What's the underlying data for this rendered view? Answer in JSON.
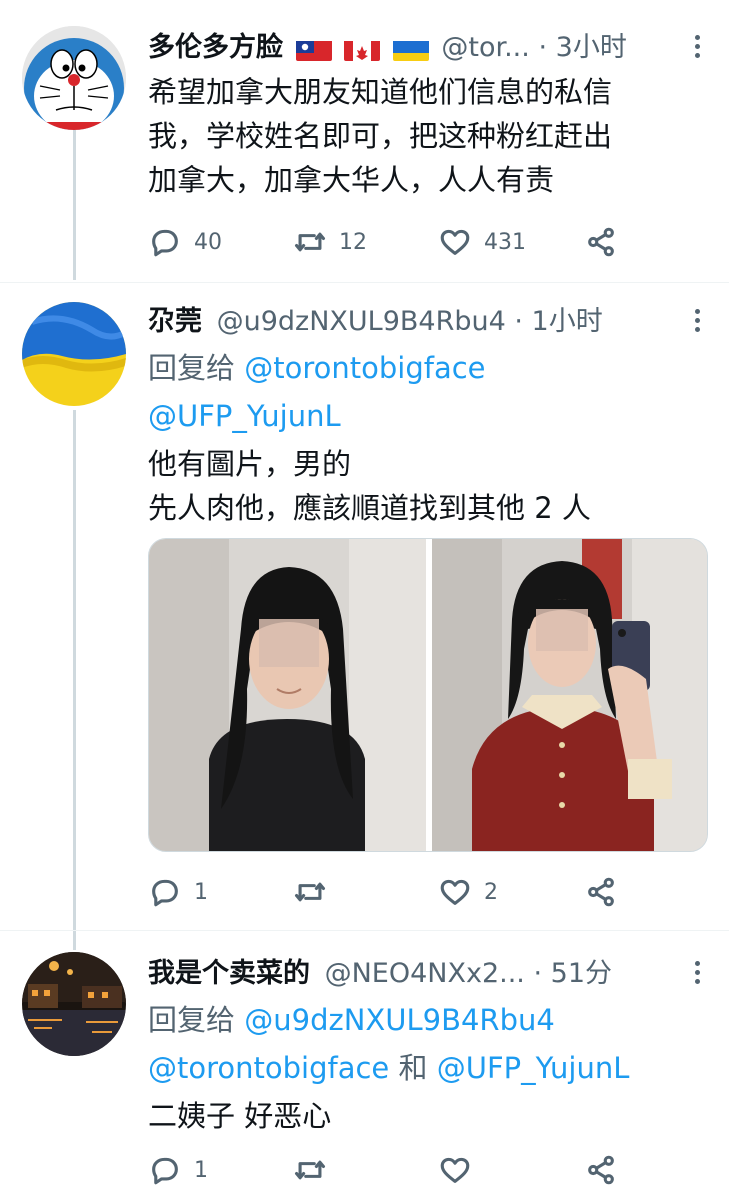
{
  "tweets": [
    {
      "name": "多伦多方脸",
      "flags": [
        "taiwan-flag",
        "canada-flag",
        "ukraine-flag"
      ],
      "handle": "@tor...",
      "dot": "·",
      "time": "3小时",
      "text_lines": [
        "希望加拿大朋友知道他们信息的私信",
        "我，学校姓名即可，把这种粉红赶出",
        "加拿大，加拿大华人，人人有责"
      ],
      "replies": "40",
      "retweets": "12",
      "likes": "431",
      "avatar": "doraemon-avatar"
    },
    {
      "name": "尕莞",
      "handle": "@u9dzNXUL9B4Rbu4",
      "dot": "·",
      "time": "1小时",
      "reply_prefix": "回复给",
      "reply_users": [
        "@torontobigface",
        "@UFP_YujunL"
      ],
      "text_lines": [
        "他有圖片，男的",
        "先人肉他，應該順道找到其他 2 人"
      ],
      "replies": "1",
      "retweets": "",
      "likes": "2",
      "avatar": "ukraine-flag-avatar"
    },
    {
      "name": "我是个卖菜的",
      "handle": "@NEO4NXx2...",
      "dot": "·",
      "time": "51分",
      "reply_prefix": "回复给",
      "reply_users": [
        "@u9dzNXUL9B4Rbu4",
        "@torontobigface",
        "@UFP_YujunL"
      ],
      "reply_and": "和",
      "text_lines": [
        "二姨子 好恶心"
      ],
      "replies": "1",
      "retweets": "",
      "likes": "",
      "avatar": "night-town-avatar"
    }
  ],
  "colors": {
    "link": "#1d9bf0",
    "muted": "#536471",
    "text": "#0f1419",
    "thread_line": "#cfd9de"
  }
}
